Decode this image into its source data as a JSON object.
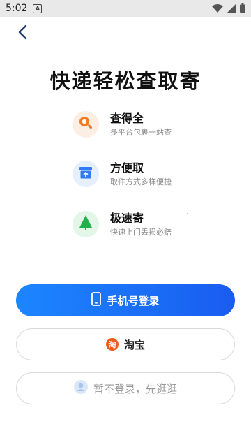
{
  "status_bar": {
    "time": "5:02",
    "notification_icon": "A"
  },
  "header": {
    "back_icon": "chevron-left-icon"
  },
  "title": "快递轻松查取寄",
  "features": [
    {
      "title": "查得全",
      "subtitle": "多平台包裹一站查",
      "icon": "search-icon",
      "color": "#f47a1f"
    },
    {
      "title": "方便取",
      "subtitle": "取件方式多样便捷",
      "icon": "box-icon",
      "color": "#2f7cf6"
    },
    {
      "title": "极速寄",
      "subtitle": "快速上门丢损必赔",
      "icon": "tree-icon",
      "color": "#22b04b"
    }
  ],
  "buttons": {
    "phone_login": "手机号登录",
    "taobao": "淘宝",
    "taobao_icon_text": "淘",
    "guest": "暂不登录，先逛逛"
  },
  "colors": {
    "primary": "#1a6ff5",
    "accent_orange": "#f05a1a"
  }
}
